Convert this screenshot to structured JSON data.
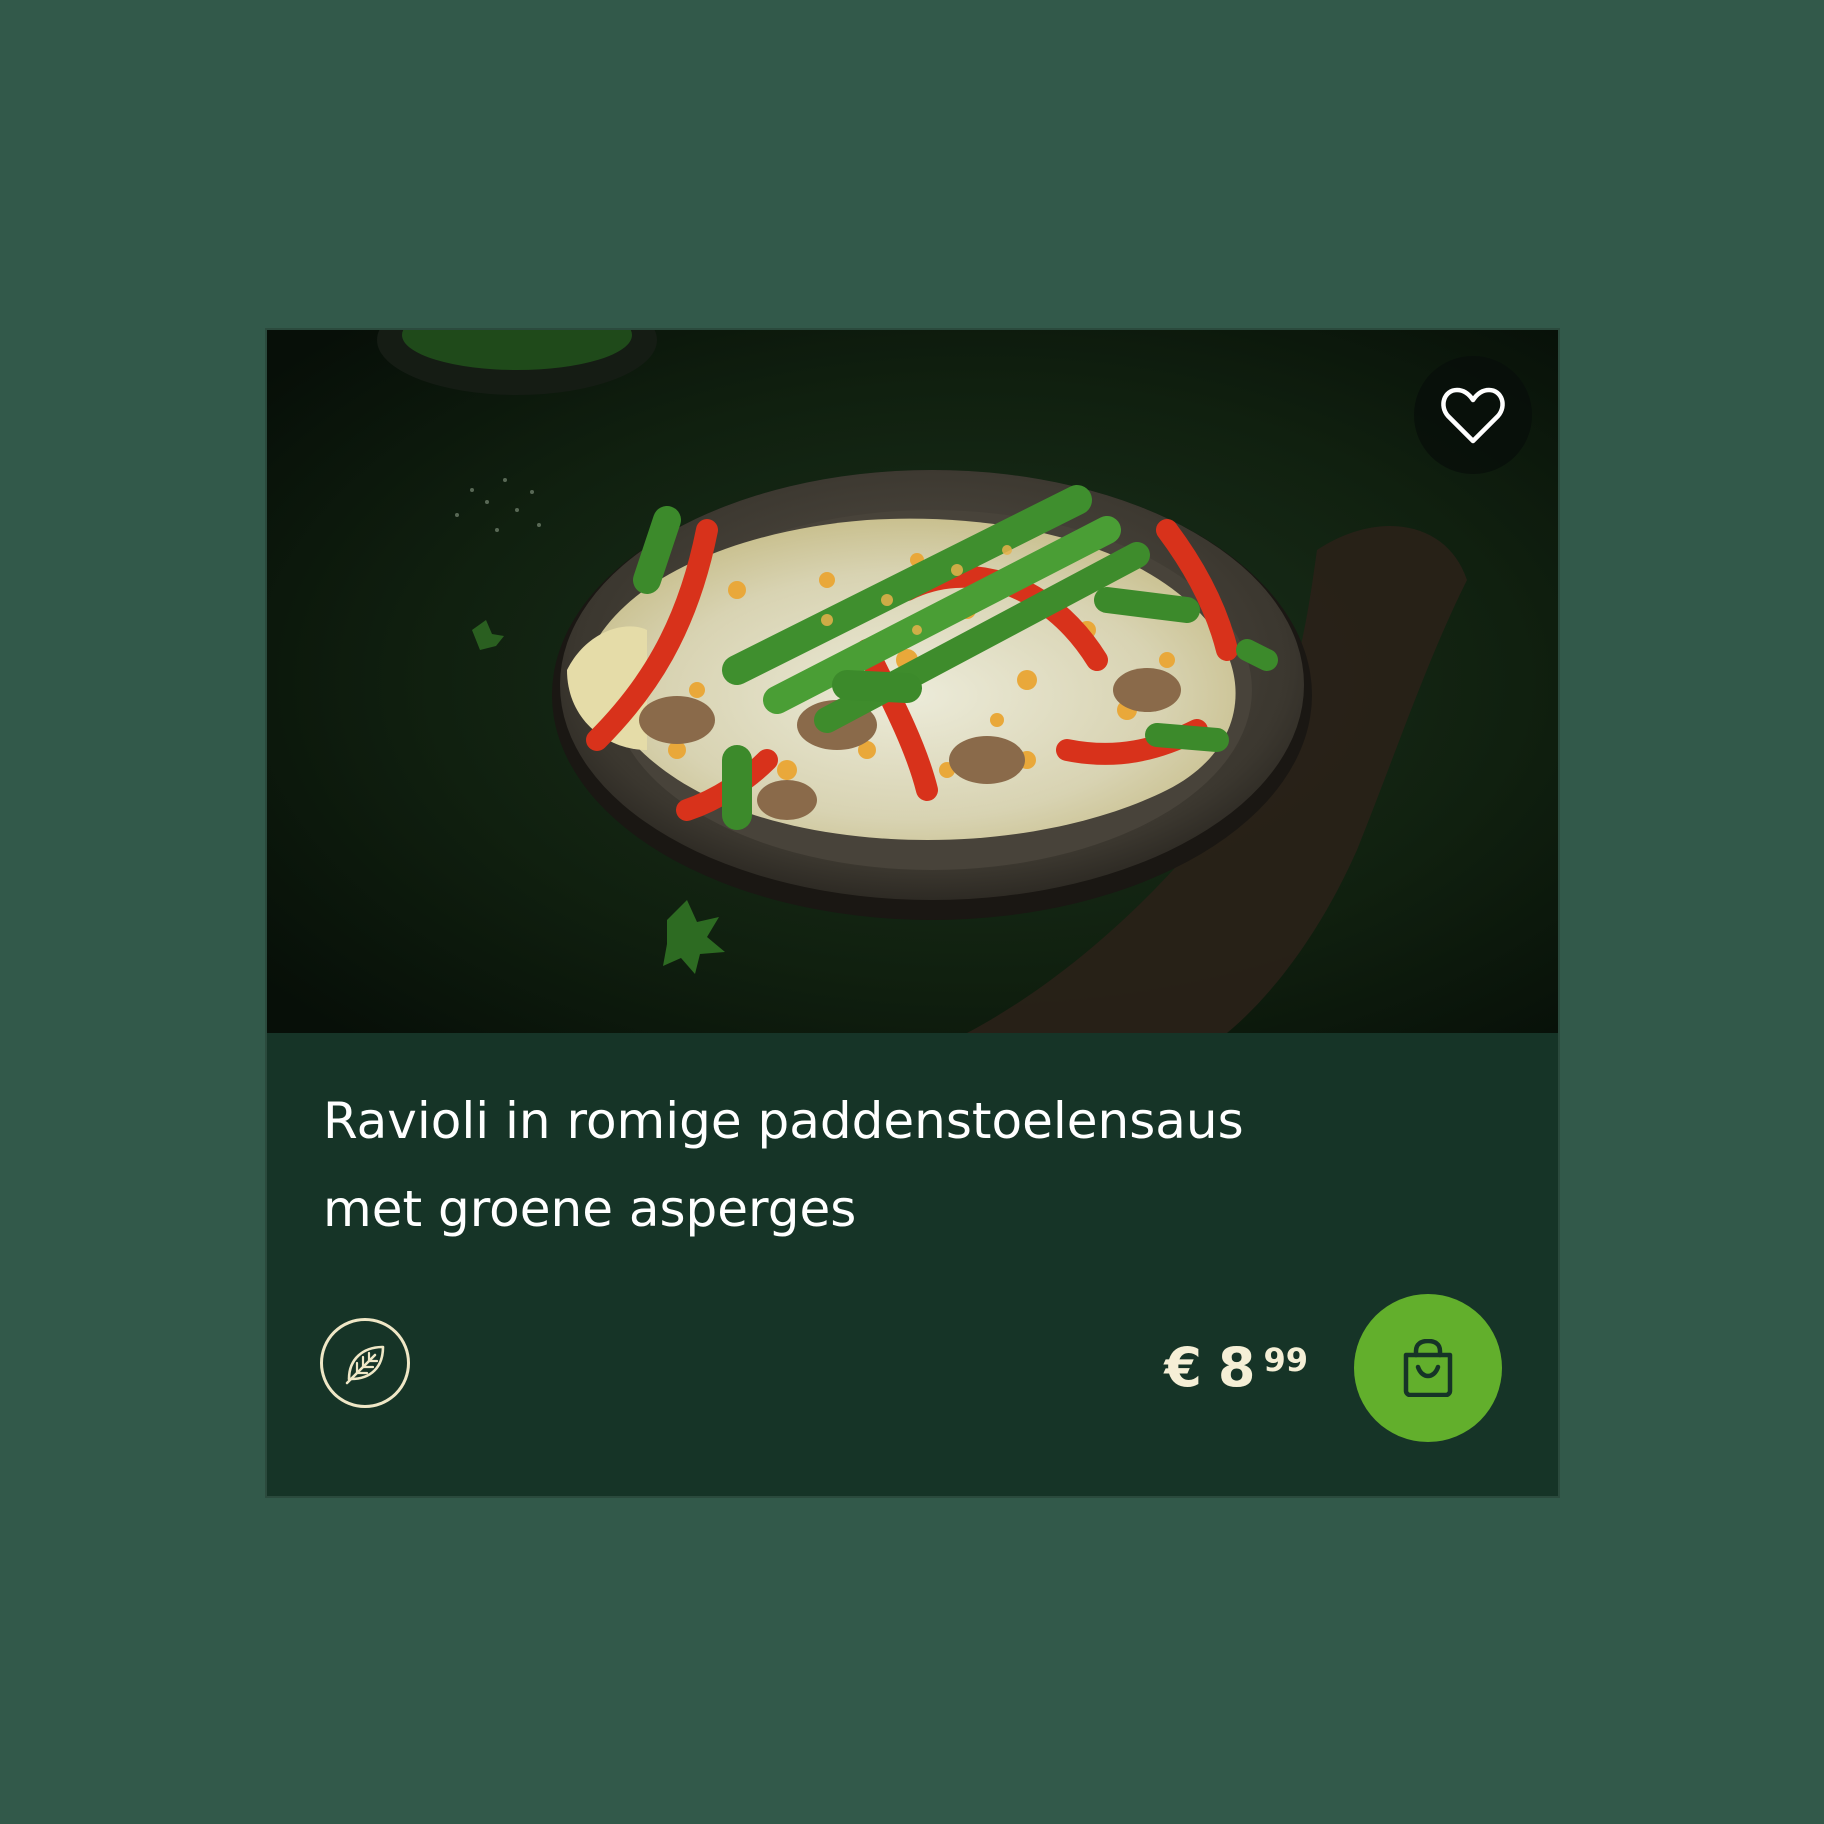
{
  "product": {
    "title_line1": "Ravioli in romige paddenstoelensaus",
    "title_line2": "met groene asperges",
    "price": {
      "currency": "€",
      "euros": "8",
      "cents": "99"
    }
  },
  "colors": {
    "page_background": "#32594a",
    "card_background": "#163427",
    "cart_button": "#62af2c",
    "badge_stroke": "#efe7c6",
    "price_text": "#f5efd6"
  },
  "icons": {
    "favorite": "heart-icon",
    "vegetarian": "leaf-icon",
    "cart": "shopping-bag-icon"
  }
}
